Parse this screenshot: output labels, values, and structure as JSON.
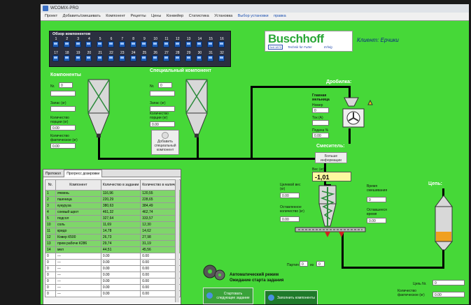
{
  "window": {
    "title": "WCOMIX-PRO"
  },
  "menu": [
    "Проект",
    "Добавить/смешивать",
    "Компонент",
    "Рецепты",
    "Цены",
    "Конвейер",
    "Статистика",
    "Установка",
    "Выбор установки",
    "правка"
  ],
  "overview": {
    "title": "Обзор компонентов",
    "row1": [
      "1",
      "2",
      "3",
      "4",
      "5",
      "6",
      "7",
      "8",
      "9",
      "10",
      "11",
      "12",
      "13",
      "14",
      "15",
      "16"
    ],
    "row2": [
      "17",
      "18",
      "19",
      "20",
      "21",
      "22",
      "23",
      "24",
      "25",
      "26",
      "27",
      "28",
      "29",
      "30",
      "31",
      "32"
    ]
  },
  "brand": {
    "name": "Buschhoff",
    "year": "Seit 1873",
    "tagline": "Technik für Futter",
    "erfolg": "Erfolg",
    "client": "Клиент: Ерчики"
  },
  "components": {
    "title": "Компоненты",
    "nr_label": "Nr.",
    "nr_value": "0",
    "stock_label": "Запас (кг)",
    "qty_label": "Количество порции (кг)",
    "qty_value": "0.00",
    "actual_label": "Количество фактическое (кг)",
    "actual_value": "0.00"
  },
  "special": {
    "title": "Специальный компонент",
    "nr_label": "Nr.",
    "nr_value": "0",
    "stock_label": "Запас (кг)",
    "qty_label": "Количество порции (кг)",
    "qty_value": "0.00",
    "add_button": "Добавить специальный компонент"
  },
  "crusher": {
    "title": "Дробилка:",
    "mill_label": "Главная мельница",
    "number_label": "Номер",
    "number_value": "0",
    "current_label": "Ток (A)",
    "feed_label": "Подача %",
    "feed_value": "0.00"
  },
  "mixer": {
    "title": "Смеситель:",
    "more_button": "Больше информации",
    "weight_label": "Вес (кг)",
    "weight_value": "-1,01",
    "target_label": "Целевой вес (кг)",
    "target_value": "0.00",
    "remaining_label": "Оставленное количество (кг)",
    "remaining_value": "0.00",
    "mix_time_label": "Время смешивания",
    "mix_time_value": "0",
    "rest_time_label": "Оставшееся время",
    "rest_time_value": "0.00"
  },
  "batch": {
    "label": "Партия",
    "value1": "0",
    "sep": "из",
    "value2": "0"
  },
  "status": {
    "line1": "Автоматический режим",
    "line2": "Ожидание старта задания"
  },
  "buttons": {
    "start": "Стартовать следующее задание",
    "fill": "Заполнить компоненты"
  },
  "chain": {
    "title": "Цепь:",
    "nr_label": "Цепь Nr.",
    "nr_value": "0",
    "qty_label": "Количество фактическое (кг)",
    "qty_value": "0.00"
  },
  "progress": {
    "tabs": [
      "Протокол",
      "Прогресс дозировки"
    ],
    "headers": [
      "Nr.",
      "Компонент",
      "Количество в задании",
      "Количество в наличии"
    ],
    "rows": [
      [
        "1",
        "ячмень",
        "116,96",
        "120,55"
      ],
      [
        "2",
        "пшеница",
        "220,29",
        "228,65"
      ],
      [
        "3",
        "кукуруза",
        "380,63",
        "384,49"
      ],
      [
        "4",
        "соевый шрот",
        "461,32",
        "462,74"
      ],
      [
        "5",
        "подсол",
        "327,64",
        "333,57"
      ],
      [
        "10",
        "соль",
        "11,69",
        "12,30"
      ],
      [
        "11",
        "кридо",
        "14,78",
        "14,62"
      ],
      [
        "12",
        "Ковер К500",
        "26,73",
        "27,98"
      ],
      [
        "13",
        "прем рабоче К286",
        "29,74",
        "31,19"
      ],
      [
        "14",
        "мел",
        "44,51",
        "45,56"
      ],
      [
        "0",
        "---",
        "0.00",
        "0.00"
      ],
      [
        "0",
        "---",
        "0.00",
        "0.00"
      ],
      [
        "0",
        "---",
        "0.00",
        "0.00"
      ],
      [
        "0",
        "---",
        "0.00",
        "0.00"
      ],
      [
        "0",
        "---",
        "0.00",
        "0.00"
      ],
      [
        "0",
        "---",
        "0.00",
        "0.00"
      ],
      [
        "0",
        "---",
        "0.00",
        "0.00"
      ]
    ]
  }
}
